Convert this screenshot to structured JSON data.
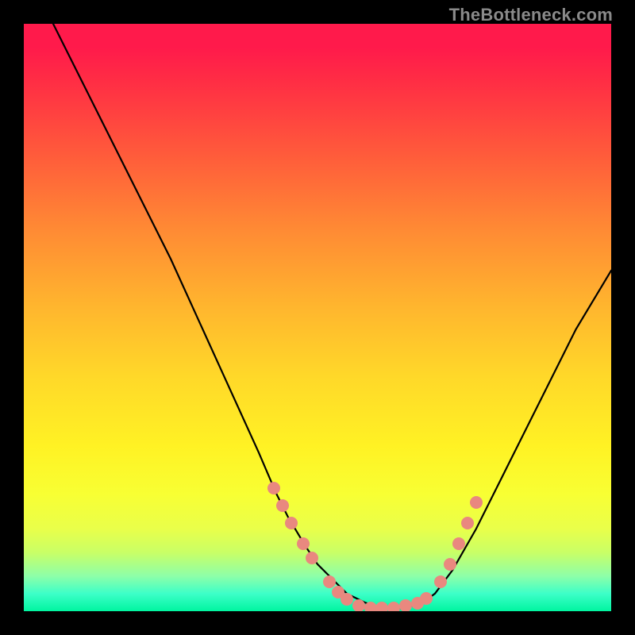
{
  "watermark": "TheBottleneck.com",
  "chart_data": {
    "type": "line",
    "title": "",
    "xlabel": "",
    "ylabel": "",
    "xlim": [
      0,
      100
    ],
    "ylim": [
      0,
      100
    ],
    "series": [
      {
        "name": "curve",
        "x": [
          5,
          10,
          15,
          20,
          25,
          30,
          35,
          40,
          43,
          45,
          48,
          50,
          53,
          55,
          58,
          60,
          63,
          65,
          68,
          70,
          73,
          77,
          82,
          88,
          94,
          100
        ],
        "y": [
          100,
          90,
          80,
          70,
          60,
          49,
          38,
          27,
          20,
          16,
          11,
          8,
          5,
          3,
          1.5,
          0.8,
          0.4,
          0.6,
          1.5,
          3,
          7,
          14,
          24,
          36,
          48,
          58
        ]
      }
    ],
    "markers": {
      "name": "dots",
      "points": [
        {
          "x": 42.5,
          "y": 21.0
        },
        {
          "x": 44.0,
          "y": 18.0
        },
        {
          "x": 45.5,
          "y": 15.0
        },
        {
          "x": 47.5,
          "y": 11.5
        },
        {
          "x": 49.0,
          "y": 9.0
        },
        {
          "x": 52.0,
          "y": 5.0
        },
        {
          "x": 53.5,
          "y": 3.2
        },
        {
          "x": 55.0,
          "y": 2.0
        },
        {
          "x": 57.0,
          "y": 1.0
        },
        {
          "x": 59.0,
          "y": 0.6
        },
        {
          "x": 61.0,
          "y": 0.5
        },
        {
          "x": 63.0,
          "y": 0.6
        },
        {
          "x": 65.0,
          "y": 0.9
        },
        {
          "x": 67.0,
          "y": 1.4
        },
        {
          "x": 68.5,
          "y": 2.1
        },
        {
          "x": 71.0,
          "y": 5.0
        },
        {
          "x": 72.5,
          "y": 8.0
        },
        {
          "x": 74.0,
          "y": 11.5
        },
        {
          "x": 75.5,
          "y": 15.0
        },
        {
          "x": 77.0,
          "y": 18.5
        }
      ]
    },
    "background": {
      "type": "vertical-gradient",
      "stops": [
        {
          "pos": 0.0,
          "color": "#ff1a4b"
        },
        {
          "pos": 0.5,
          "color": "#ffd829"
        },
        {
          "pos": 0.8,
          "color": "#f8ff33"
        },
        {
          "pos": 1.0,
          "color": "#00f5a0"
        }
      ]
    }
  }
}
